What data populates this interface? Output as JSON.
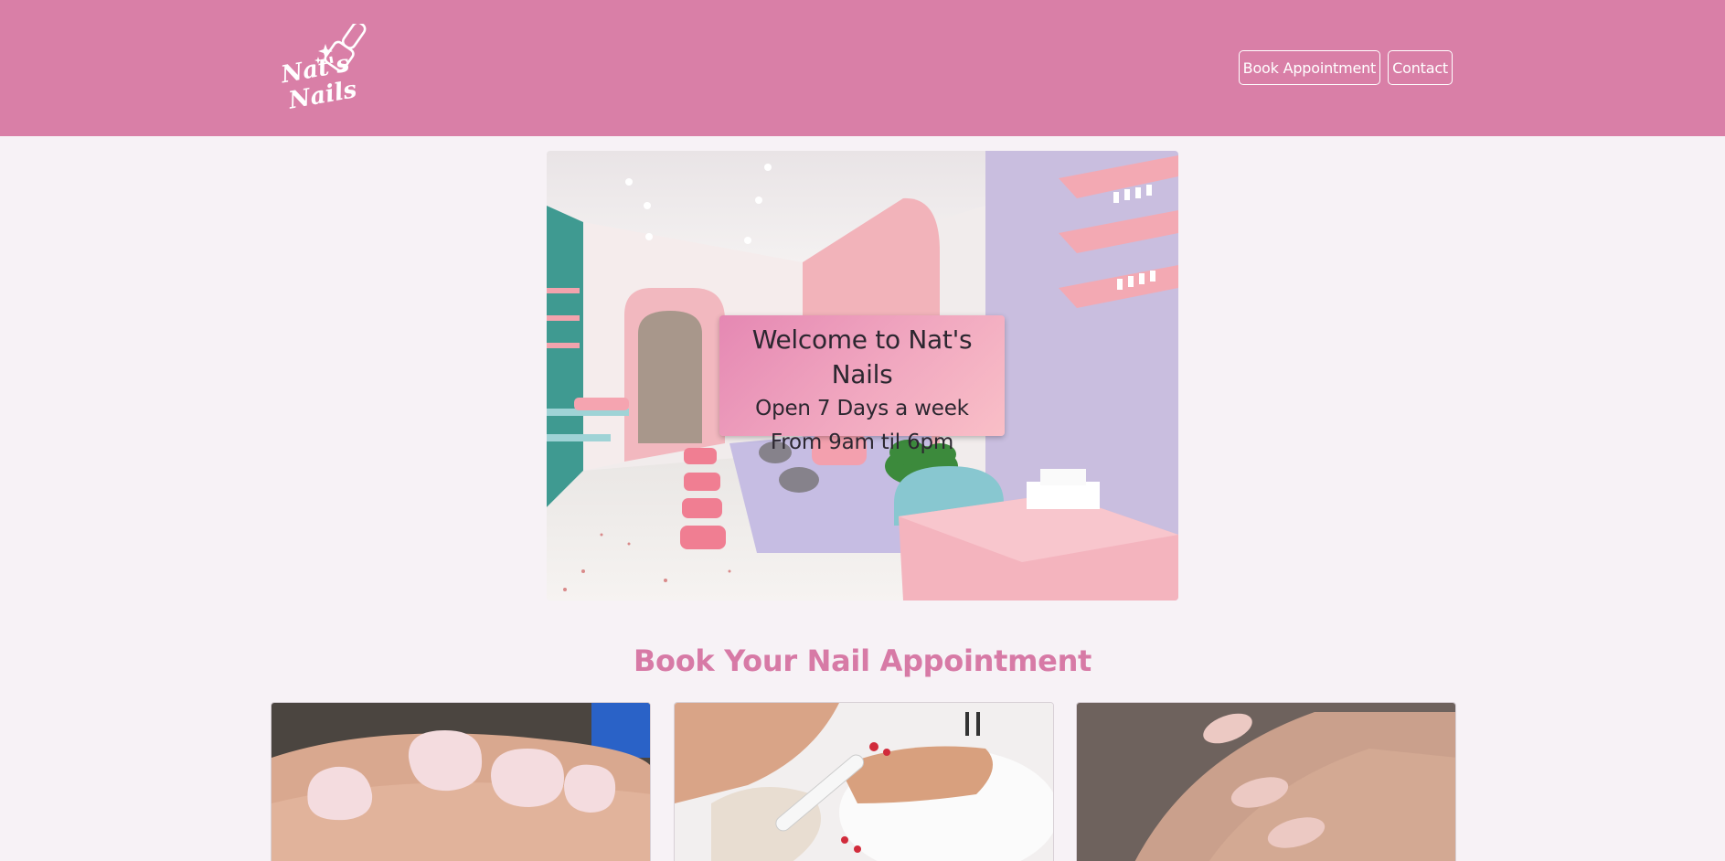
{
  "header": {
    "logo_text": "Nat's Nails",
    "nav": [
      {
        "label": "Book Appointment"
      },
      {
        "label": "Contact"
      }
    ]
  },
  "hero": {
    "title": "Welcome to Nat's Nails",
    "line1": "Open 7 Days a week",
    "line2": "From 9am til 6pm"
  },
  "section": {
    "title": "Book Your Nail Appointment"
  },
  "cards": [
    {
      "image": "pink-acrylic-nails-photo"
    },
    {
      "image": "pedicure-nail-file-photo"
    },
    {
      "image": "natural-manicure-photo"
    }
  ],
  "colors": {
    "header_bg": "#d97fa7",
    "accent_pink": "#d77aa6",
    "page_bg": "#f7f2f6"
  }
}
